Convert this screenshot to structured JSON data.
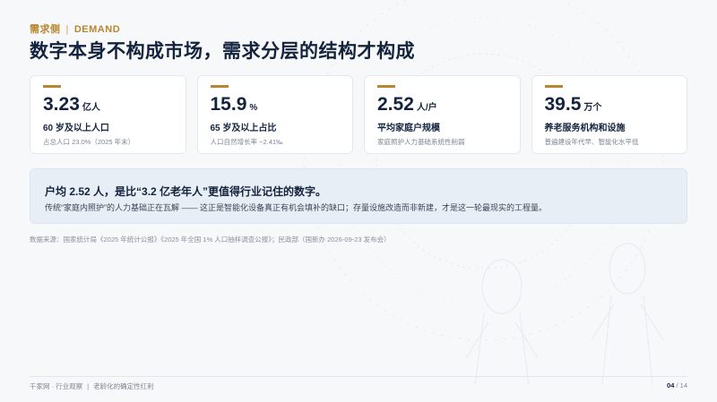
{
  "header": {
    "tag_cn": "需求侧",
    "tag_sep": "|",
    "tag_en": "DEMAND",
    "title": "数字本身不构成市场，需求分层的结构才构成"
  },
  "cards": [
    {
      "value": "3.23",
      "unit": "亿人",
      "label": "60 岁及以上人口",
      "note": "占总人口 23.0%（2025 年末）"
    },
    {
      "value": "15.9",
      "unit": "%",
      "label": "65 岁及以上占比",
      "note": "人口自然增长率 −2.41‰"
    },
    {
      "value": "2.52",
      "unit": "人/户",
      "label": "平均家庭户规模",
      "note": "家庭照护人力基础系统性削弱"
    },
    {
      "value": "39.5",
      "unit": "万个",
      "label": "养老服务机构和设施",
      "note": "普遍建设年代早、智能化水平低"
    }
  ],
  "callout": {
    "headline": "户均 2.52 人，是比“3.2 亿老年人”更值得行业记住的数字。",
    "body": "传统“家庭内照护”的人力基础正在瓦解 —— 这正是智能化设备真正有机会填补的缺口；存量设施改造而非新建，才是这一轮最现实的工程量。"
  },
  "source": "数据来源：国家统计局《2025 年统计公报》《2025 年全国 1% 人口抽样调查公报》；民政部（国新办 2026-09-23 发布会）",
  "footer": {
    "brand": "千家网 · 行业观察",
    "sep": "|",
    "topic": "老龄化的确定性红利",
    "page_current": "04",
    "page_total": "/ 14"
  },
  "colors": {
    "accent": "#b8862e",
    "navy": "#13233d",
    "callout_bg": "#e8eef6"
  }
}
